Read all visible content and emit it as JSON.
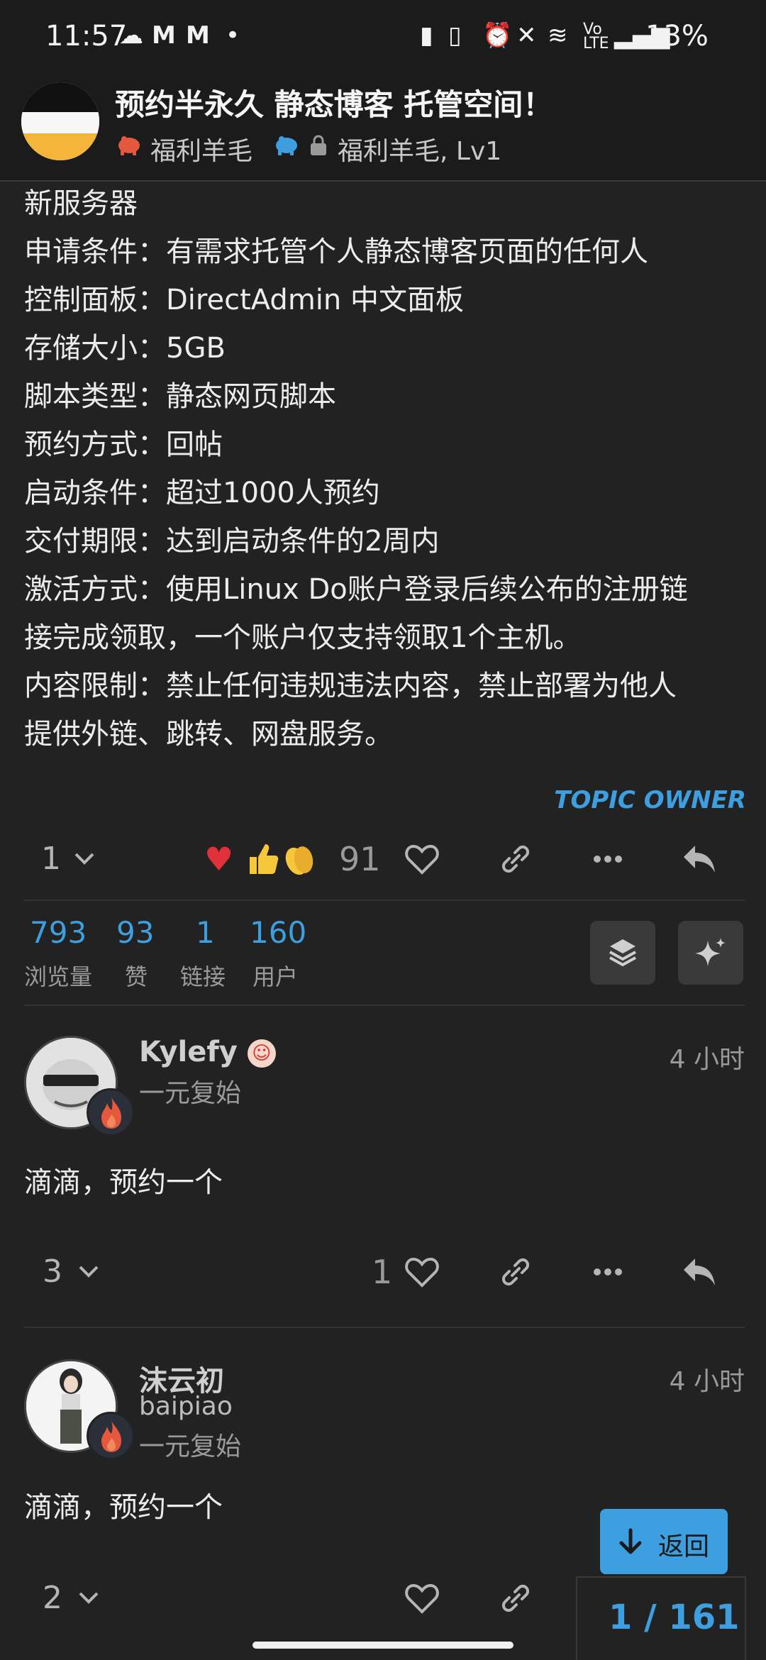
{
  "status_bar": {
    "time": "11:57",
    "battery": "13%"
  },
  "header": {
    "title": "预约半永久 静态博客 托管空间！",
    "category": "福利羊毛",
    "subcategory": "福利羊毛, Lv1"
  },
  "post": {
    "lines": [
      "新服务器",
      "申请条件：有需求托管个人静态博客页面的任何人",
      "控制面板：DirectAdmin 中文面板",
      "存储大小：5GB",
      "脚本类型：静态网页脚本",
      "预约方式：回帖",
      "启动条件：超过1000人预约",
      "交付期限：达到启动条件的2周内",
      "激活方式：使用Linux Do账户登录后续公布的注册链",
      "接完成领取，一个账户仅支持领取1个主机。",
      "内容限制：禁止任何违规违法内容，禁止部署为他人",
      "提供外链、跳转、网盘服务。"
    ],
    "owner_badge": "TOPIC OWNER",
    "reply_count": "1",
    "reactions_count": "91"
  },
  "stats": [
    {
      "value": "793",
      "label": "浏览量"
    },
    {
      "value": "93",
      "label": "赞"
    },
    {
      "value": "1",
      "label": "链接"
    },
    {
      "value": "160",
      "label": "用户"
    }
  ],
  "replies": [
    {
      "username": "Kylefy",
      "title": "一元复始",
      "time": "4 小时",
      "body": "滴滴，预约一个",
      "reply_count": "3",
      "like_count": "1"
    },
    {
      "username": "沫云初",
      "subname": "baipiao",
      "title": "一元复始",
      "time": "4 小时",
      "body": "滴滴，预约一个",
      "reply_count": "2"
    }
  ],
  "back_button": "返回",
  "progress": "1 / 161",
  "colors": {
    "accent": "#3d9fe0",
    "background": "#222222"
  }
}
